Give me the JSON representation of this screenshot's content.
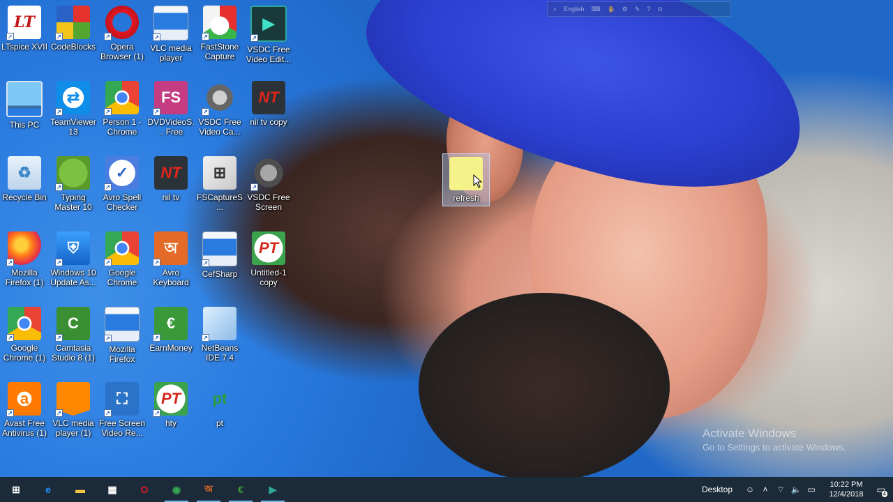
{
  "desktop": {
    "icons": [
      {
        "label": "LTspice XVII",
        "glyph": "LT",
        "icon": "ltspice-icon"
      },
      {
        "label": "CodeBlocks",
        "glyph": "",
        "icon": "codeblocks-icon"
      },
      {
        "label": "Opera Browser (1)",
        "glyph": "",
        "icon": "opera-icon"
      },
      {
        "label": "VLC media player",
        "glyph": "",
        "icon": "vlc-window-icon"
      },
      {
        "label": "FastStone Capture",
        "glyph": "",
        "icon": "faststone-icon"
      },
      {
        "label": "VSDC Free Video Edit...",
        "glyph": "▶",
        "icon": "vsdc-editor-icon"
      },
      {
        "label": "This PC",
        "glyph": "",
        "icon": "computer-icon"
      },
      {
        "label": "TeamViewer 13",
        "glyph": "⇄",
        "icon": "teamviewer-icon"
      },
      {
        "label": "Person 1 - Chrome",
        "glyph": "",
        "icon": "chrome-icon"
      },
      {
        "label": "DVDVideoS... Free Studio",
        "glyph": "FS",
        "icon": "dvdvideosoft-icon"
      },
      {
        "label": "VSDC Free Video Ca...",
        "glyph": "",
        "icon": "webcam-icon"
      },
      {
        "label": "nil tv copy",
        "glyph": "NT",
        "icon": "niltv-icon"
      },
      {
        "label": "Recycle Bin",
        "glyph": "♻",
        "icon": "recycle-bin-icon"
      },
      {
        "label": "Typing Master 10",
        "glyph": "",
        "icon": "typing-master-icon"
      },
      {
        "label": "Avro Spell Checker",
        "glyph": "✓",
        "icon": "check-icon"
      },
      {
        "label": "nil tv",
        "glyph": "NT",
        "icon": "niltv-icon"
      },
      {
        "label": "FSCaptureS...",
        "glyph": "⊞",
        "icon": "installer-icon"
      },
      {
        "label": "VSDC Free Screen Rec...",
        "glyph": "",
        "icon": "screen-recorder-icon"
      },
      {
        "label": "Mozilla Firefox (1)",
        "glyph": "",
        "icon": "firefox-icon"
      },
      {
        "label": "Windows 10 Update As...",
        "glyph": "⛨",
        "icon": "windows-update-icon"
      },
      {
        "label": "Google Chrome",
        "glyph": "",
        "icon": "chrome-icon"
      },
      {
        "label": "Avro Keyboard",
        "glyph": "অ",
        "icon": "avro-keyboard-icon"
      },
      {
        "label": "CefSharp",
        "glyph": "",
        "icon": "cefsharp-window-icon"
      },
      {
        "label": "Untitled-1 copy",
        "glyph": "PT",
        "icon": "pt-logo-icon"
      },
      {
        "label": "Google Chrome (1)",
        "glyph": "",
        "icon": "chrome-icon"
      },
      {
        "label": "Camtasia Studio 8 (1)",
        "glyph": "C",
        "icon": "camtasia-icon"
      },
      {
        "label": "Mozilla Firefox",
        "glyph": "",
        "icon": "firefox-window-icon"
      },
      {
        "label": "EarnMoney",
        "glyph": "€",
        "icon": "earnmoney-icon"
      },
      {
        "label": "NetBeans IDE 7.4",
        "glyph": "",
        "icon": "netbeans-icon"
      },
      {
        "label": "Avast Free Antivirus (1)",
        "glyph": "a",
        "icon": "avast-icon"
      },
      {
        "label": "VLC media player (1)",
        "glyph": "",
        "icon": "vlc-cone-icon"
      },
      {
        "label": "Free Screen Video Re...",
        "glyph": "⛶",
        "icon": "screen-capture-icon"
      },
      {
        "label": "hty",
        "glyph": "PT",
        "icon": "pt-logo-icon"
      },
      {
        "label": "pt",
        "glyph": "pt",
        "icon": "pt-image-icon"
      }
    ],
    "selected_icon": {
      "label": "refresh",
      "icon": "refresh-file-icon"
    }
  },
  "language_bar": {
    "language": "English"
  },
  "watermark": {
    "title": "Activate Windows",
    "subtitle": "Go to Settings to activate Windows."
  },
  "taskbar": {
    "apps": [
      {
        "name": "start-button",
        "glyph": "⊞",
        "color": "#ffffff"
      },
      {
        "name": "edge-button",
        "glyph": "e",
        "color": "#1e90ff"
      },
      {
        "name": "file-explorer-button",
        "glyph": "▬",
        "color": "#f2c744"
      },
      {
        "name": "store-button",
        "glyph": "▦",
        "color": "#ffffff"
      },
      {
        "name": "opera-button",
        "glyph": "O",
        "color": "#e21823"
      },
      {
        "name": "chrome-button",
        "glyph": "◉",
        "color": "#34a853"
      },
      {
        "name": "avro-button",
        "glyph": "অ",
        "color": "#e46a27"
      },
      {
        "name": "earnmoney-button",
        "glyph": "€",
        "color": "#3a9a3a"
      },
      {
        "name": "vsdc-button",
        "glyph": "▶",
        "color": "#2fa89a"
      }
    ],
    "tray": {
      "desktop_label": "Desktop",
      "time": "10:22 PM",
      "date": "12/4/2018",
      "notification_count": "4"
    }
  }
}
